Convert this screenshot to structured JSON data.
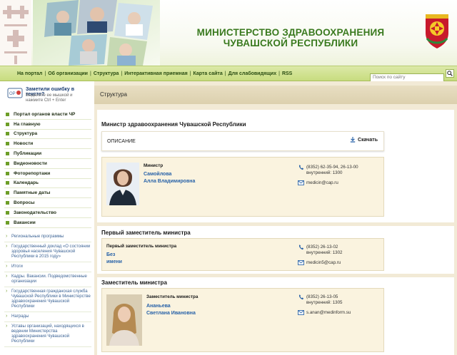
{
  "header": {
    "title_line1": "МИНИСТЕРСТВО ЗДРАВООХРАНЕНИЯ",
    "title_line2": "ЧУВАШСКОЙ РЕСПУБЛИКИ",
    "brand_color": "#3a7a1f"
  },
  "nav": {
    "items": [
      "На портал",
      "Об организации",
      "Структура",
      "Интерактивная приемная",
      "Карта сайта",
      "Для слабовидящих",
      "RSS"
    ],
    "search_placeholder": "Поиск по сайту",
    "search_icon": "search-icon"
  },
  "sidebar": {
    "typo_title": "Заметили ошибку в тексте?",
    "typo_hint": "Выделите ее мышкой и нажмите Ctrl + Enter",
    "menu": [
      "Портал органов власти ЧР",
      "На главную",
      "Структура",
      "Новости",
      "Публикации",
      "Видеоновости",
      "Фоторепортажи",
      "Календарь",
      "Памятные даты",
      "Вопросы",
      "Законодательство",
      "Вакансии"
    ],
    "sub": [
      "Региональные программы",
      "Государственный доклад «О состоянии здоровья населения Чувашской Республики в 2015 году»",
      "Итоги",
      "Кадры. Вакансии. Подведомственные организации",
      "Государственная гражданская служба Чувашской Республики в Министерстве здравоохранения Чувашской Республики",
      "Награды",
      "Уставы организаций, находящихся в ведении Министерства здравоохранения Чувашской Республики"
    ]
  },
  "main": {
    "breadcrumb": "Структура",
    "minister_section": "Министр здравоохранения Чувашской Республики",
    "description_label": "ОПИСАНИЕ",
    "download_label": "Скачать",
    "cards": [
      {
        "role": "Министр",
        "surname": "Самойлова",
        "name": "Алла Владимировна",
        "phone": "(8352) 62-35-94, 26-13-00",
        "internal": "внутренний: 1300",
        "email": "medicin@cap.ru"
      },
      {
        "section": "Первый заместитель министра",
        "role": "Первый заместитель министра",
        "surname": "Без",
        "name": "имени",
        "phone": "(8352) 26-13-02",
        "internal": "внутренний: 1302",
        "email": "medicin5@cap.ru"
      },
      {
        "section": "Заместитель министра",
        "role": "Заместитель министра",
        "surname": "Ананьева",
        "name": "Светлана Ивановна",
        "phone": "(8352) 26-13-05",
        "internal": "внутренний: 1305",
        "email": "s.anan@medinform.su"
      }
    ]
  }
}
